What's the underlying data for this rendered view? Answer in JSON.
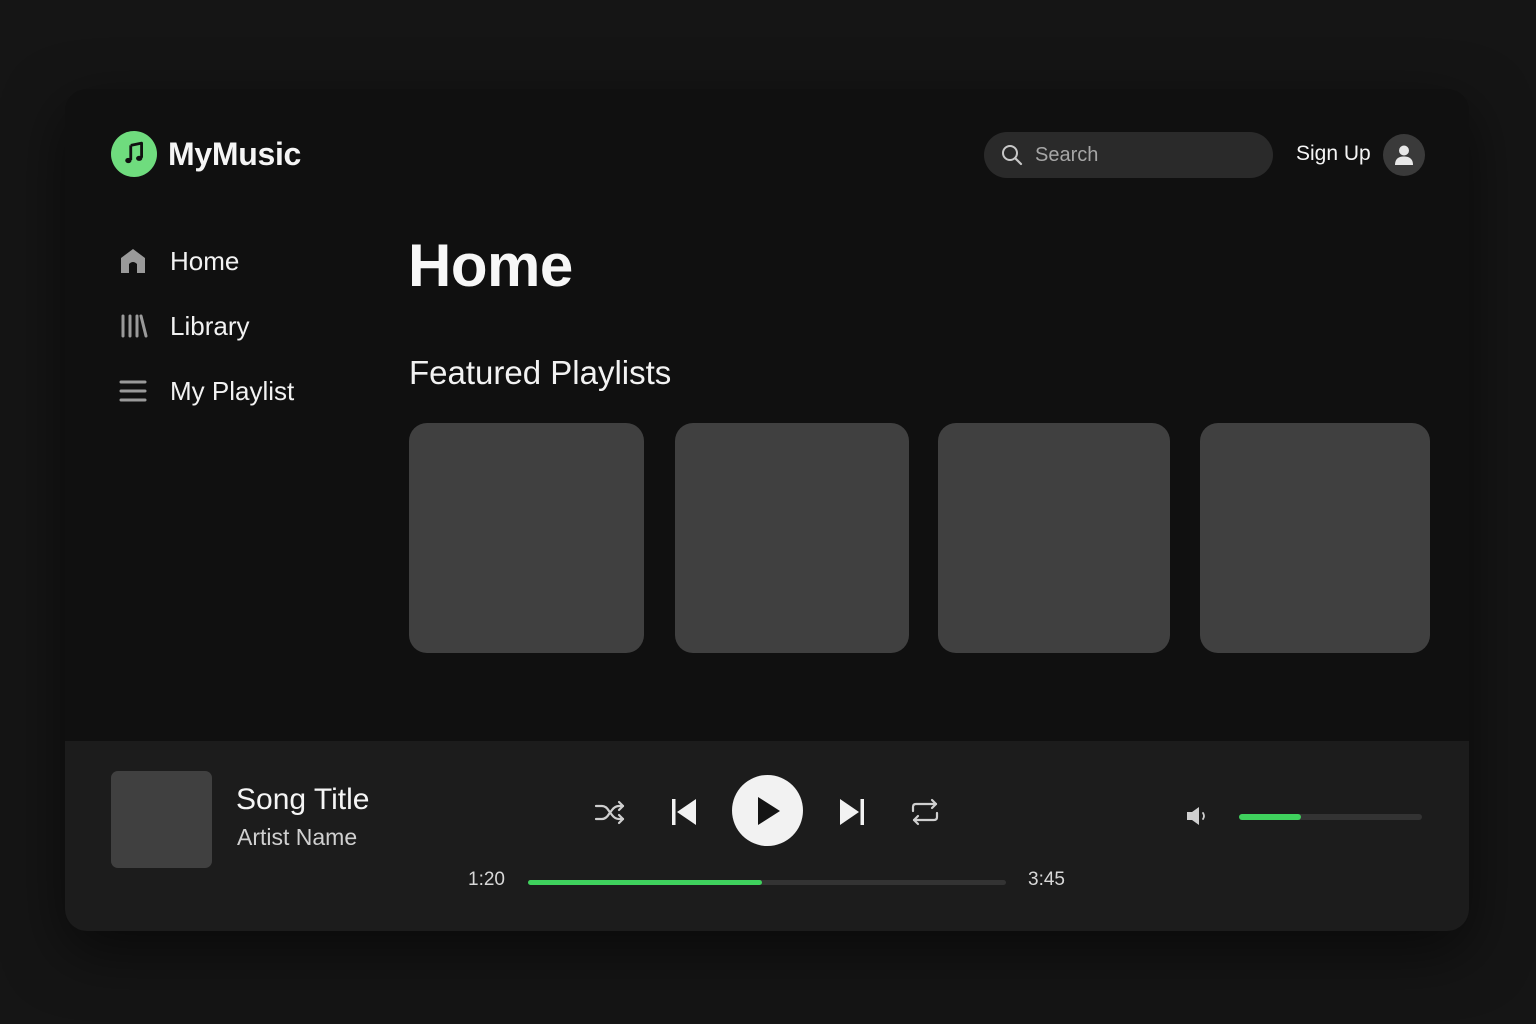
{
  "app": {
    "name": "MyMusic"
  },
  "header": {
    "search_placeholder": "Search",
    "signup_label": "Sign Up"
  },
  "sidebar": {
    "items": [
      {
        "label": "Home",
        "icon": "home-icon"
      },
      {
        "label": "Library",
        "icon": "library-icon"
      },
      {
        "label": "My Playlist",
        "icon": "playlist-icon"
      }
    ]
  },
  "main": {
    "title": "Home",
    "section_title": "Featured Playlists",
    "playlist_count": 4
  },
  "player": {
    "song_title": "Song Title",
    "artist_name": "Artist Name",
    "current_time": "1:20",
    "total_time": "3:45",
    "progress_fraction": 0.49,
    "volume_fraction": 0.34,
    "controls": [
      "shuffle-icon",
      "previous-icon",
      "play-icon",
      "next-icon",
      "repeat-icon"
    ]
  },
  "colors": {
    "accent": "#3fd15d",
    "logo": "#6fdc7e",
    "background": "#101010",
    "card": "#404040",
    "player_bar": "#1c1c1c"
  }
}
